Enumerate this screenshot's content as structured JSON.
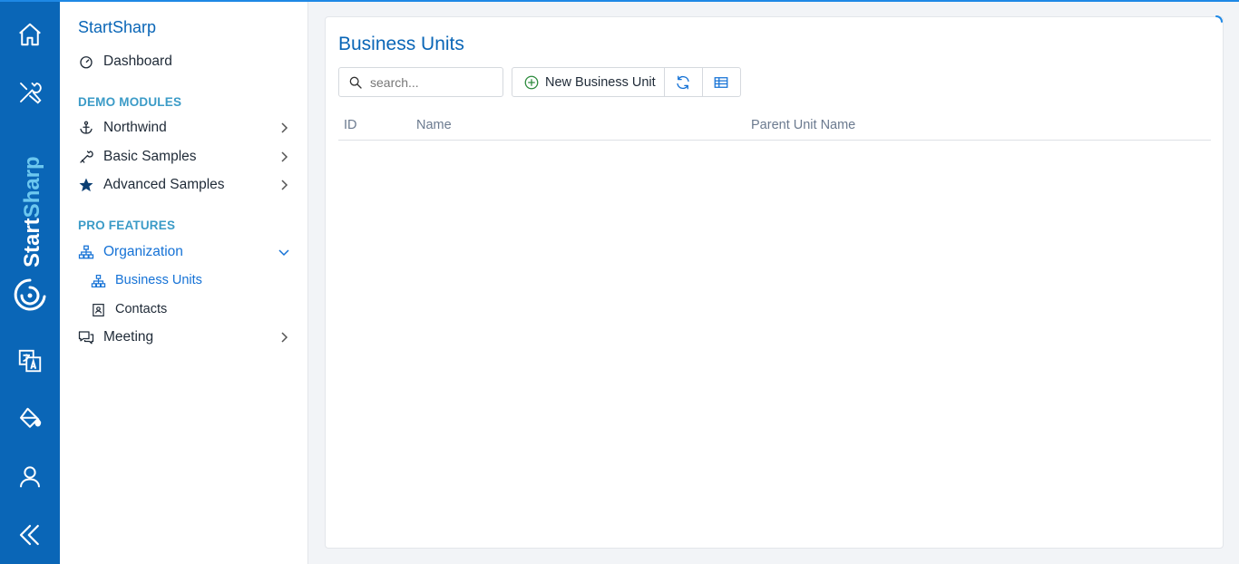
{
  "app": {
    "brand_vertical": "StartSharp",
    "accent": "#0a66b7",
    "rail": [
      "home-icon",
      "tools-icon",
      "translate-icon",
      "paint-bucket-icon",
      "user-icon",
      "collapse-icon"
    ]
  },
  "sidebar": {
    "brand": "StartSharp",
    "dashboard": "Dashboard",
    "section_demo": "DEMO MODULES",
    "northwind": "Northwind",
    "basic_samples": "Basic Samples",
    "advanced_samples": "Advanced Samples",
    "section_pro": "PRO FEATURES",
    "organization": "Organization",
    "business_units": "Business Units",
    "contacts": "Contacts",
    "meeting": "Meeting"
  },
  "main": {
    "title": "Business Units",
    "search_placeholder": "search...",
    "new_button": "New Business Unit",
    "columns": [
      "ID",
      "Name",
      "Parent Unit Name"
    ]
  }
}
